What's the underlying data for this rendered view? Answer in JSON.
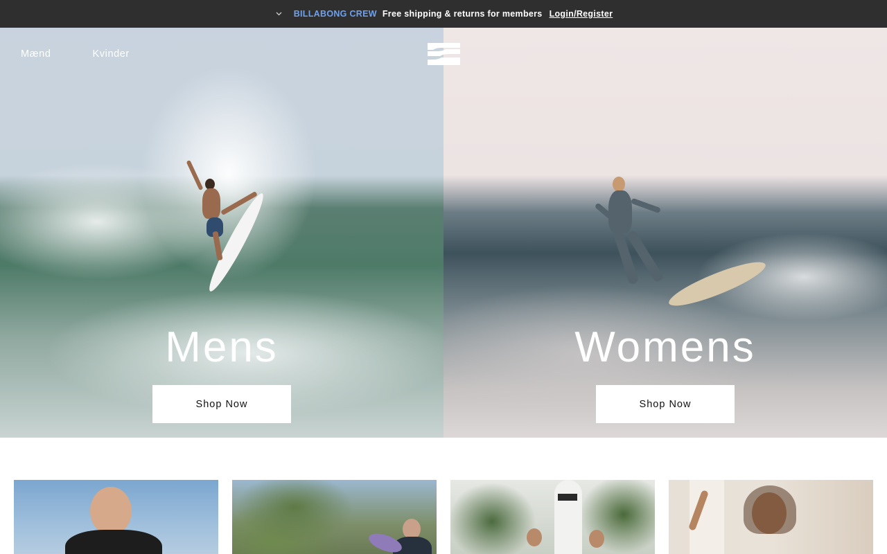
{
  "announcement": {
    "crew_label": "BILLABONG CREW",
    "message": "Free shipping & returns for members",
    "login_label": "Login/Register"
  },
  "nav": {
    "men_label": "Mænd",
    "women_label": "Kvinder"
  },
  "brand": {
    "name": "Billabong",
    "logo_icon": "billabong-wave-logo-icon"
  },
  "hero": {
    "left": {
      "title": "Mens",
      "button_label": "Shop Now"
    },
    "right": {
      "title": "Womens",
      "button_label": "Shop Now"
    }
  },
  "colors": {
    "topbar_bg": "#2f2f2f",
    "crew_accent": "#6ea2ee",
    "button_bg": "#ffffff",
    "button_text": "#111111"
  },
  "categories": [
    {
      "name": "category-card-1"
    },
    {
      "name": "category-card-2"
    },
    {
      "name": "category-card-3"
    },
    {
      "name": "category-card-4"
    }
  ]
}
